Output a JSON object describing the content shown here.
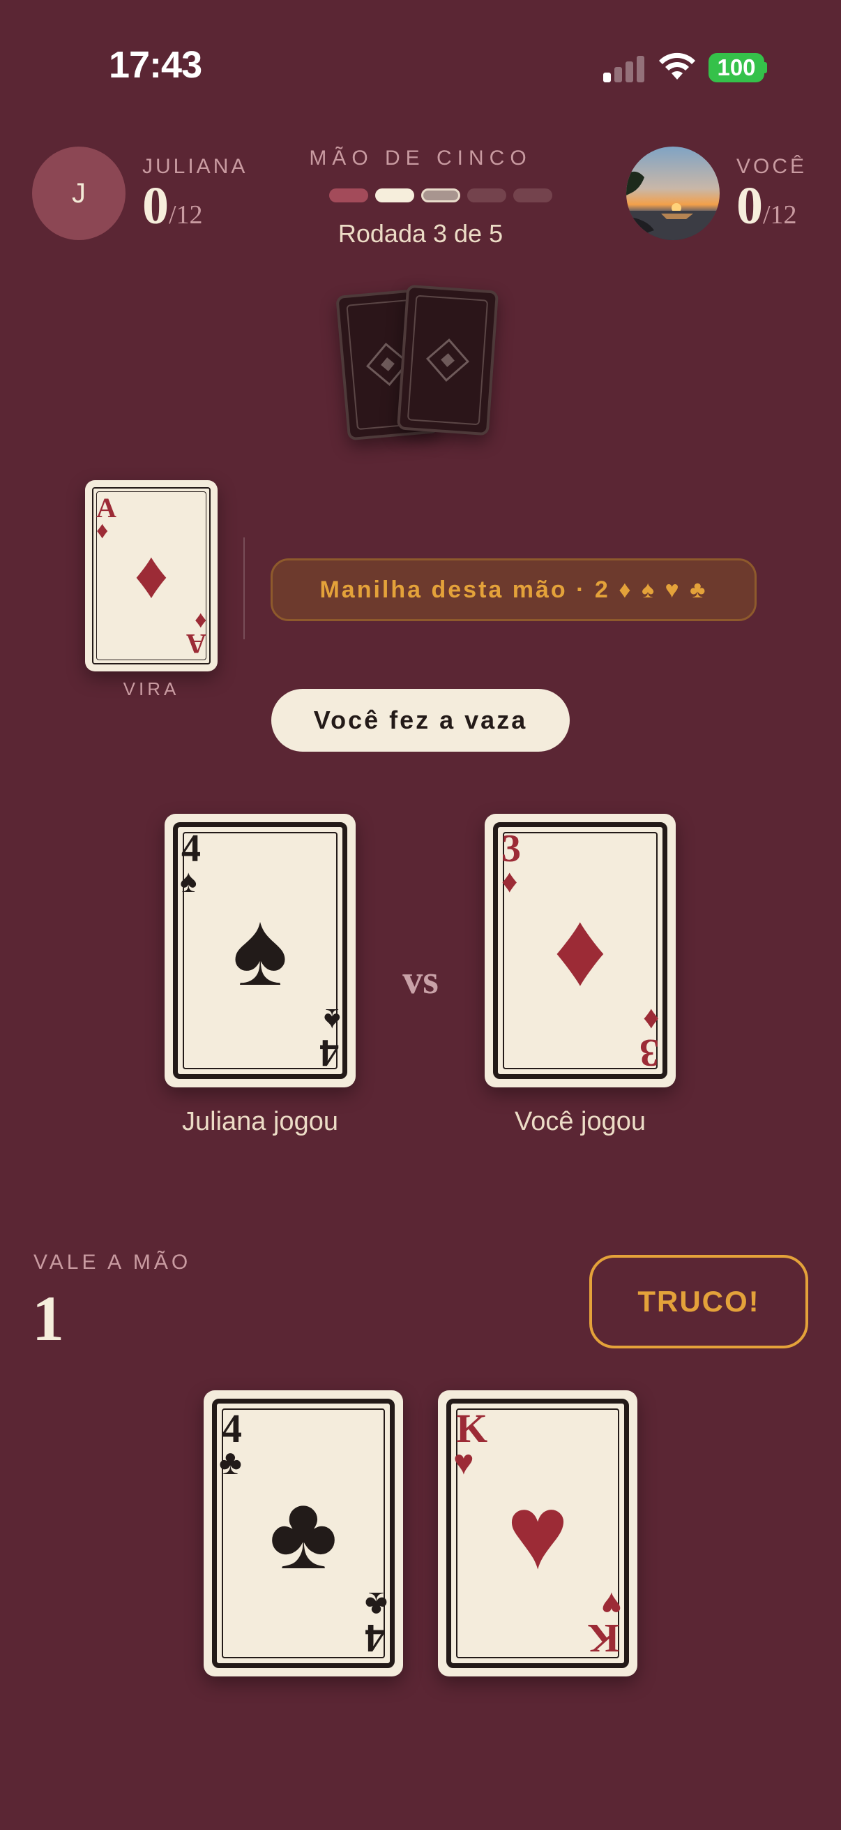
{
  "status_bar": {
    "time": "17:43",
    "battery": "100"
  },
  "opponent": {
    "name": "JULIANA",
    "initial": "J",
    "score": "0",
    "score_max": "/12"
  },
  "player": {
    "name": "VOCÊ",
    "score": "0",
    "score_max": "/12"
  },
  "header": {
    "mode": "MÃO DE CINCO",
    "round_text": "Rodada 3 de 5",
    "round_current": 3,
    "round_total": 5
  },
  "vira": {
    "label": "VIRA",
    "rank": "A",
    "suit": "♦",
    "color": "red"
  },
  "manilha": {
    "text": "Manilha desta mão · 2 ♦ ♠ ♥ ♣"
  },
  "toast": {
    "text": "Você fez a vaza"
  },
  "trick": {
    "vs": "vs",
    "opponent_card": {
      "rank": "4",
      "suit": "♠",
      "color": "black"
    },
    "opponent_label": "Juliana jogou",
    "player_card": {
      "rank": "3",
      "suit": "♦",
      "color": "red"
    },
    "player_label": "Você jogou"
  },
  "stake": {
    "label": "VALE A MÃO",
    "value": "1"
  },
  "truco_button": {
    "label": "TRUCO!"
  },
  "hand": [
    {
      "rank": "4",
      "suit": "♣",
      "color": "black"
    },
    {
      "rank": "K",
      "suit": "♥",
      "color": "red"
    }
  ],
  "colors": {
    "background": "#5b2634",
    "card_face": "#f4ecdc",
    "accent_gold": "#e4a23a",
    "red_suit": "#9c2b36",
    "black_suit": "#221b19"
  }
}
